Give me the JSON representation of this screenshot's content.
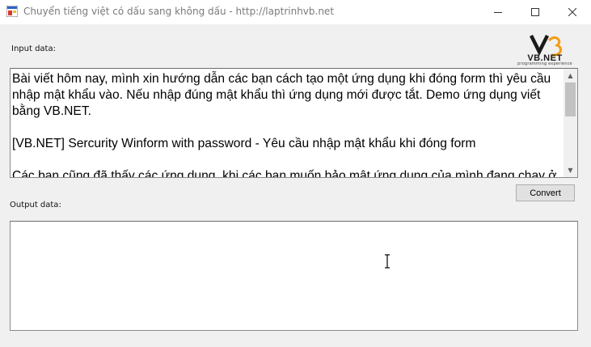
{
  "window": {
    "title": "Chuyển tiếng việt có dấu sang không dấu - http://laptrinhvb.net",
    "controls": {
      "minimize": "minimize-icon",
      "maximize": "maximize-icon",
      "close": "close-icon"
    }
  },
  "logo": {
    "text": "VB.NET",
    "subtitle": "programming experience"
  },
  "input": {
    "label": "Input data:",
    "text": "Bài viết hôm nay, mình xin hướng dẫn các bạn cách tạo một ứng dụng khi đóng form thì yêu cầu nhập mật khẩu vào. Nếu nhập đúng mật khẩu thì ứng dụng mới được tắt. Demo ứng dụng viết bằng VB.NET.\n\n[VB.NET] Sercurity Winform with password - Yêu cầu nhập mật khẩu khi đóng form\n\nCác bạn cũng đã thấy các ứng dụng, khi các bạn muốn bảo mật ứng dụng của mình đang chạy ở"
  },
  "convert_button": {
    "label": "Convert"
  },
  "output": {
    "label": "Output data:",
    "text": ""
  },
  "colors": {
    "titlebar": "#ffffff",
    "window_bg": "#f0f0f0",
    "button_bg": "#e1e1e1",
    "logo_orange": "#f39c12"
  }
}
